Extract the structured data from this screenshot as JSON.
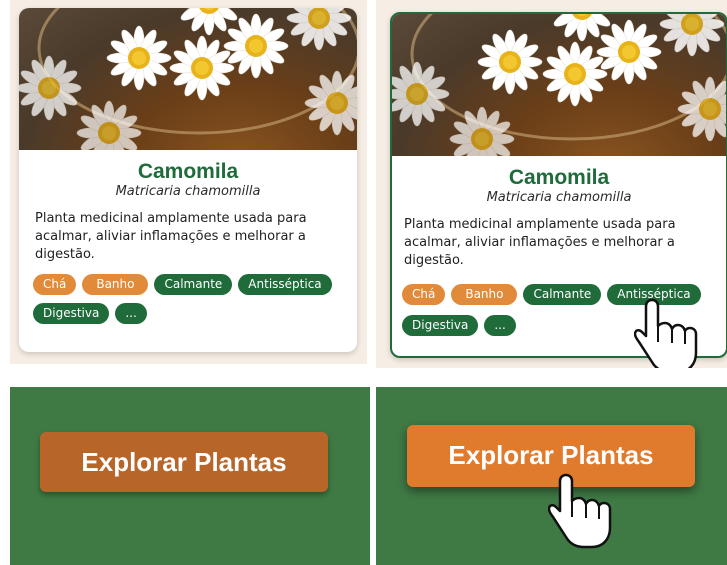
{
  "card": {
    "title": "Camomila",
    "scientific_name": "Matricaria chamomilla",
    "description": "Planta medicinal amplamente usada para acalmar, aliviar inflamações e melhorar a digestão.",
    "tags": [
      {
        "label": "Chá",
        "color": "#e08a3a"
      },
      {
        "label": "Banho",
        "color": "#e08a3a"
      },
      {
        "label": "Calmante",
        "color": "#1f6b3a"
      },
      {
        "label": "Antisséptica",
        "color": "#1f6b3a"
      },
      {
        "label": "Digestiva",
        "color": "#1f6b3a"
      },
      {
        "label": "...",
        "color": "#1f6b3a"
      }
    ]
  },
  "button": {
    "label": "Explorar Plantas",
    "default_color": "#b8652a",
    "hover_color": "#e07a2c"
  },
  "background_color": "#3f7a45",
  "cursor_icon": "hand-pointer-icon"
}
